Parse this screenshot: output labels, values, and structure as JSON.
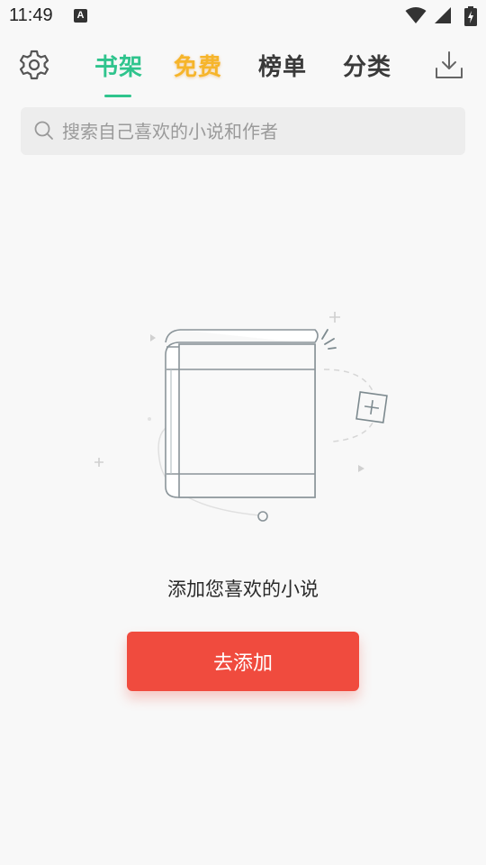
{
  "status_bar": {
    "time": "11:49",
    "notification_icon": "A",
    "icons": [
      "wifi-icon",
      "signal-icon",
      "battery-charging-icon"
    ]
  },
  "header": {
    "settings_icon": "gear-icon",
    "tabs": [
      {
        "label": "书架",
        "active": true
      },
      {
        "label": "免费",
        "active": false,
        "highlight": "#f6b52a"
      },
      {
        "label": "榜单",
        "active": false
      },
      {
        "label": "分类",
        "active": false
      }
    ],
    "download_icon": "download-icon",
    "accent_color": "#2fc48d"
  },
  "search": {
    "placeholder": "搜索自己喜欢的小说和作者",
    "value": "",
    "icon": "search-icon"
  },
  "empty_state": {
    "illustration": "book-with-plus-illustration",
    "message": "添加您喜欢的小说",
    "button_label": "去添加",
    "button_color": "#f04b3e"
  }
}
